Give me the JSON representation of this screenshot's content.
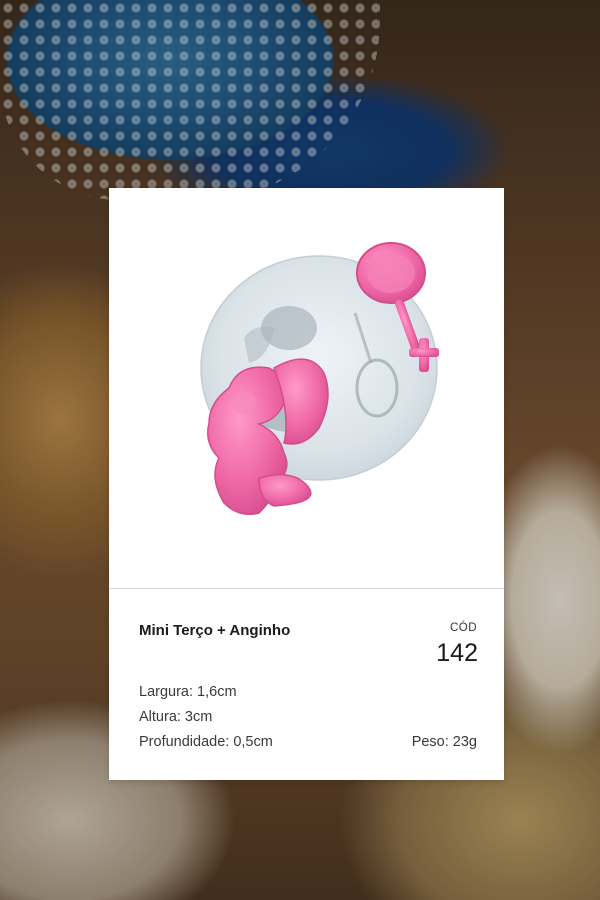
{
  "product": {
    "name": "Mini Terço + Anginho",
    "code_label": "CÓD",
    "code": "142",
    "width": "Largura: 1,6cm",
    "height": "Altura: 3cm",
    "depth": "Profundidade: 0,5cm",
    "weight": "Peso: 23g"
  },
  "colors": {
    "mold": "#dfe6ea",
    "pink_piece": "#f06aa8"
  }
}
